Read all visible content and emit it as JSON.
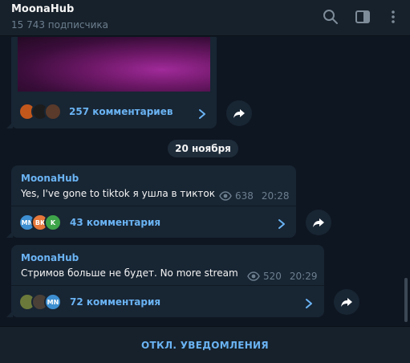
{
  "header": {
    "title": "MoonaHub",
    "subtitle": "15 743 подписчика"
  },
  "date_separator": "20 ноября",
  "posts": [
    {
      "comments_label": "257 комментариев"
    },
    {
      "sender": "MoonaHub",
      "text": "Yes, I've gone to tiktok я ушла в тикток",
      "views": "638",
      "time": "20:28",
      "avatars": [
        {
          "initials": "MN",
          "color": "#3d8fd1"
        },
        {
          "initials": "BK",
          "color": "#e5773a"
        },
        {
          "initials": "K",
          "color": "#3ea44a"
        }
      ],
      "comments_label": "43 комментария"
    },
    {
      "sender": "MoonaHub",
      "text": "Стримов больше не будет. No more stream",
      "views": "520",
      "time": "20:29",
      "avatars": [
        {
          "initials": "MN",
          "color": "#3d8fd1"
        }
      ],
      "comments_label": "72 комментария"
    }
  ],
  "footer": {
    "button_label": "ОТКЛ. УВЕДОМЛЕНИЯ"
  }
}
